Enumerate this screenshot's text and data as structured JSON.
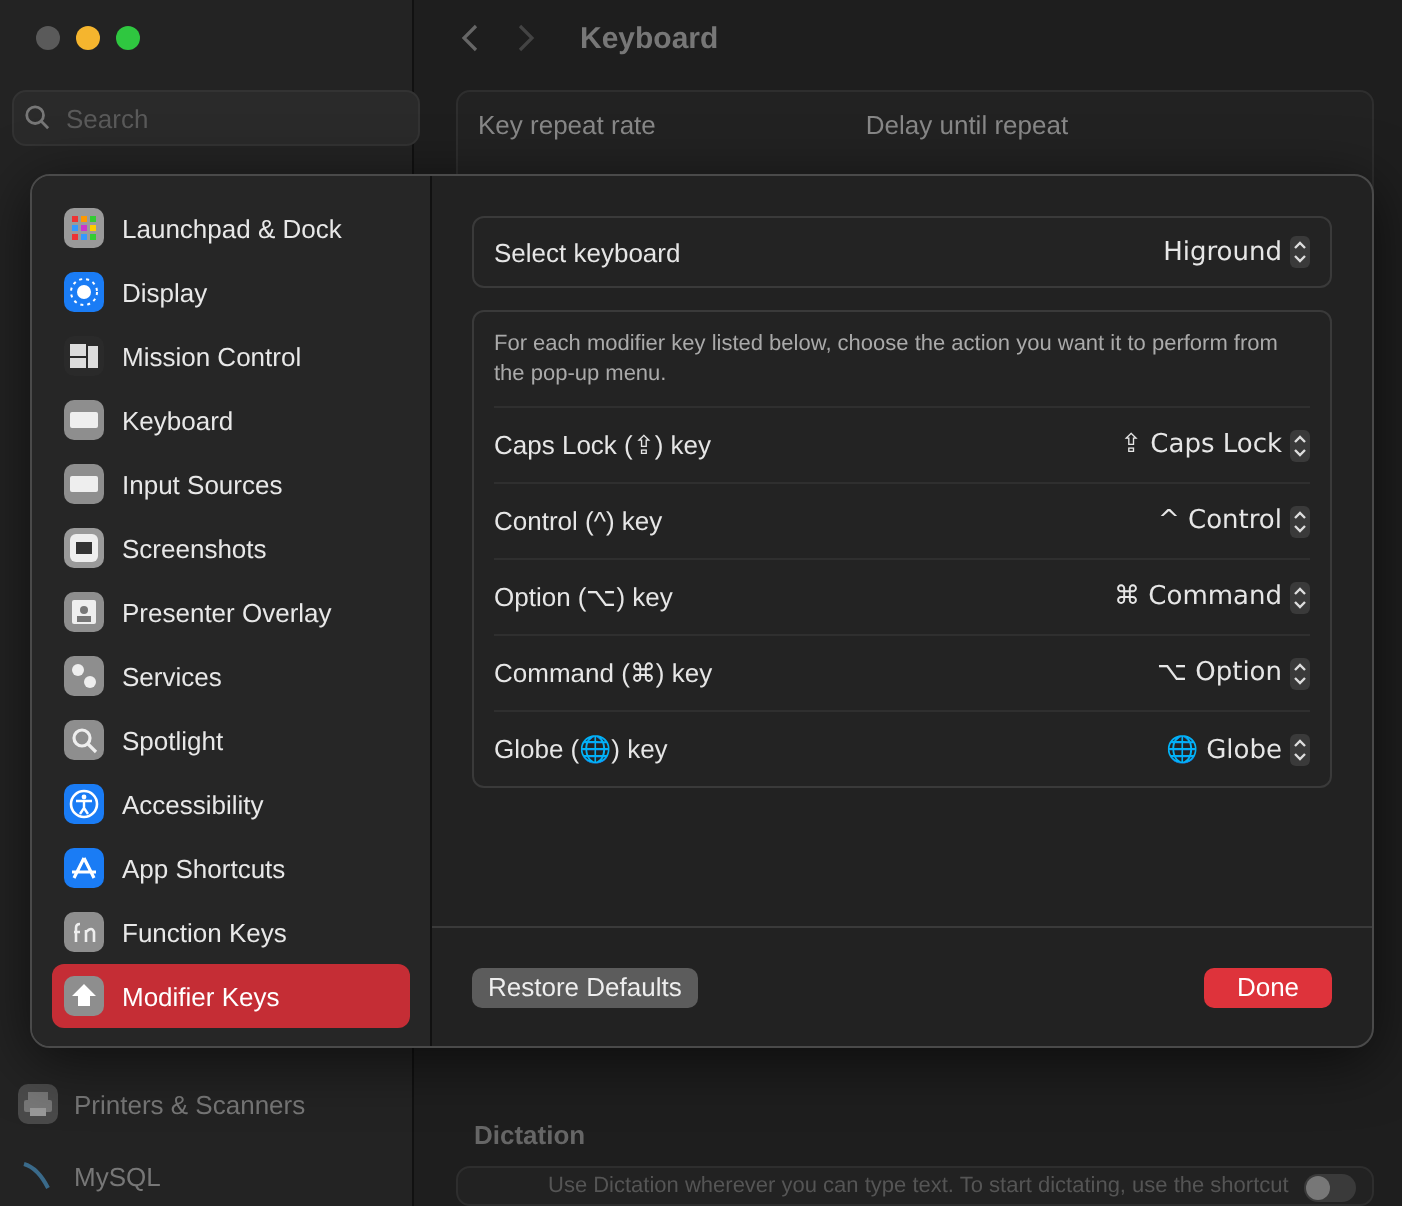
{
  "window": {
    "title": "Keyboard",
    "search": {
      "placeholder": "Search"
    }
  },
  "background": {
    "sidebar_items": [
      {
        "label": "Printers & Scanners"
      },
      {
        "label": "MySQL"
      }
    ],
    "key_repeat": {
      "labels": [
        "Key repeat rate",
        "Delay until repeat"
      ]
    },
    "dictation": {
      "heading": "Dictation",
      "text": "Use Dictation wherever you can type text. To start dictating, use the shortcut",
      "on": false
    }
  },
  "sheet": {
    "sidebar": [
      {
        "label": "Launchpad & Dock",
        "selected": false
      },
      {
        "label": "Display",
        "selected": false
      },
      {
        "label": "Mission Control",
        "selected": false
      },
      {
        "label": "Keyboard",
        "selected": false
      },
      {
        "label": "Input Sources",
        "selected": false
      },
      {
        "label": "Screenshots",
        "selected": false
      },
      {
        "label": "Presenter Overlay",
        "selected": false
      },
      {
        "label": "Services",
        "selected": false
      },
      {
        "label": "Spotlight",
        "selected": false
      },
      {
        "label": "Accessibility",
        "selected": false
      },
      {
        "label": "App Shortcuts",
        "selected": false
      },
      {
        "label": "Function Keys",
        "selected": false
      },
      {
        "label": "Modifier Keys",
        "selected": true
      }
    ],
    "select_keyboard": {
      "label": "Select keyboard",
      "value": "Higround"
    },
    "description": "For each modifier key listed below, choose the action you want it to perform from the pop-up menu.",
    "modifiers": [
      {
        "label": "Caps Lock (⇪) key",
        "value": "⇪ Caps Lock"
      },
      {
        "label": "Control (^) key",
        "value": "^ Control"
      },
      {
        "label": "Option (⌥) key",
        "value": "⌘ Command"
      },
      {
        "label": "Command (⌘) key",
        "value": "⌥ Option"
      },
      {
        "label": "Globe (🌐) key",
        "value": "🌐 Globe"
      }
    ],
    "buttons": {
      "restore": "Restore Defaults",
      "done": "Done"
    }
  }
}
